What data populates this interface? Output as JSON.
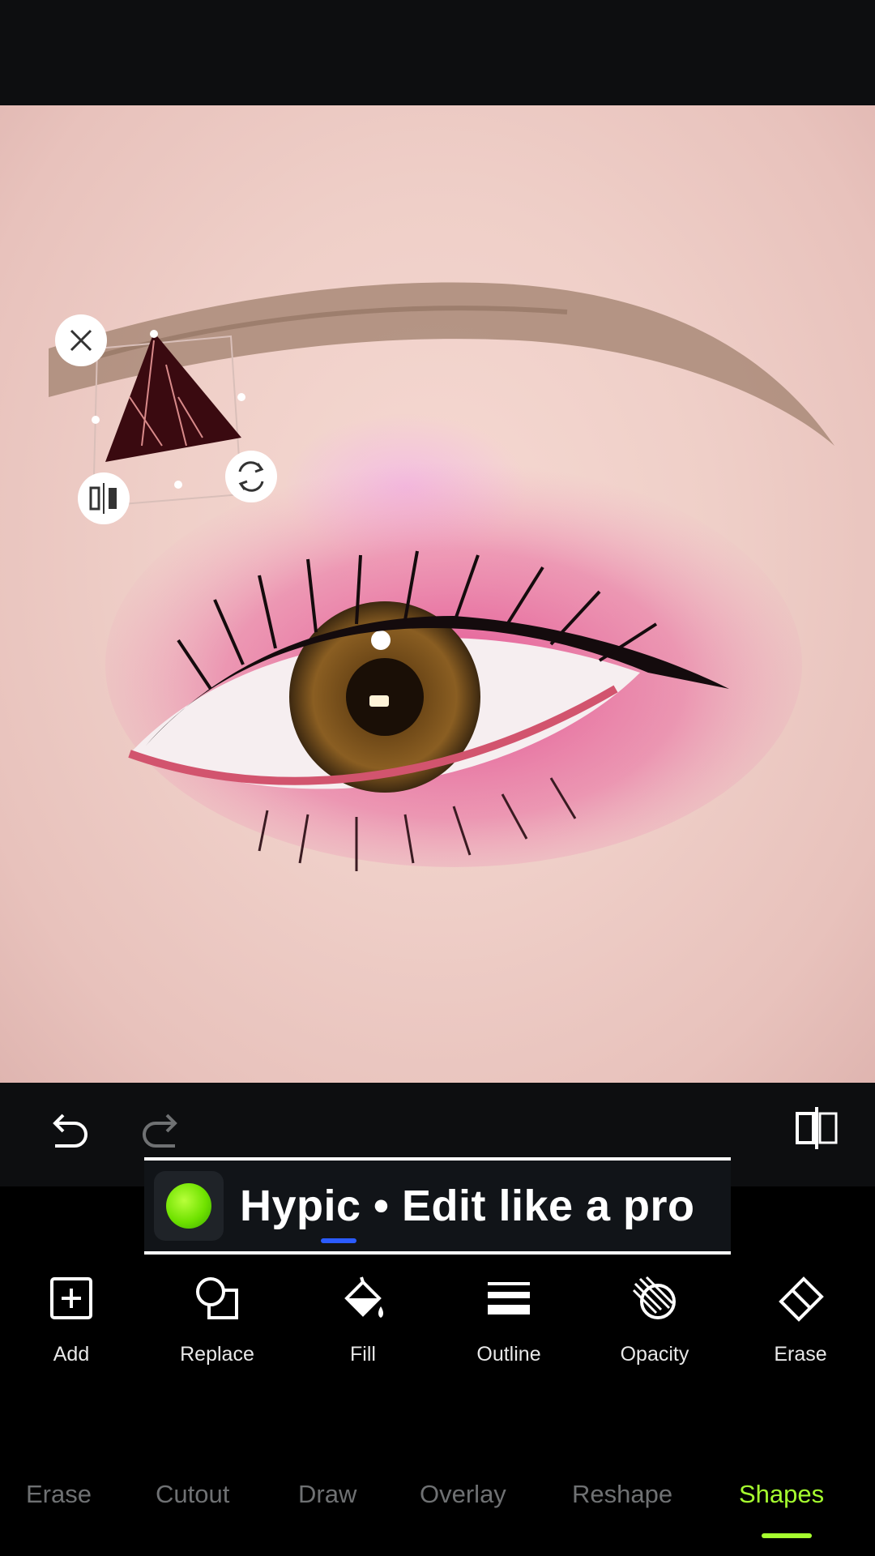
{
  "colors": {
    "accent": "#a6ff2f",
    "background": "#000000",
    "toolbar": "#0d0e10",
    "inactive_tab": "#6f7173",
    "shape_fill": "#3a0a10"
  },
  "editor": {
    "undo_icon": "undo-icon",
    "redo_icon": "redo-icon",
    "compare_icon": "compare-icon"
  },
  "sticker": {
    "shape": "triangle",
    "handles": [
      "close-icon",
      "flip-icon",
      "rotate-icon"
    ]
  },
  "banner": {
    "text": "Hypic • Edit like a pro"
  },
  "tools": [
    {
      "label": "Add",
      "icon": "add-icon"
    },
    {
      "label": "Replace",
      "icon": "replace-icon"
    },
    {
      "label": "Fill",
      "icon": "fill-icon"
    },
    {
      "label": "Outline",
      "icon": "outline-icon"
    },
    {
      "label": "Opacity",
      "icon": "opacity-icon"
    },
    {
      "label": "Erase",
      "icon": "eraser-icon"
    }
  ],
  "tabs": [
    {
      "label": "Erase",
      "active": false
    },
    {
      "label": "Cutout",
      "active": false
    },
    {
      "label": "Draw",
      "active": false
    },
    {
      "label": "Overlay",
      "active": false
    },
    {
      "label": "Reshape",
      "active": false
    },
    {
      "label": "Shapes",
      "active": true
    }
  ]
}
